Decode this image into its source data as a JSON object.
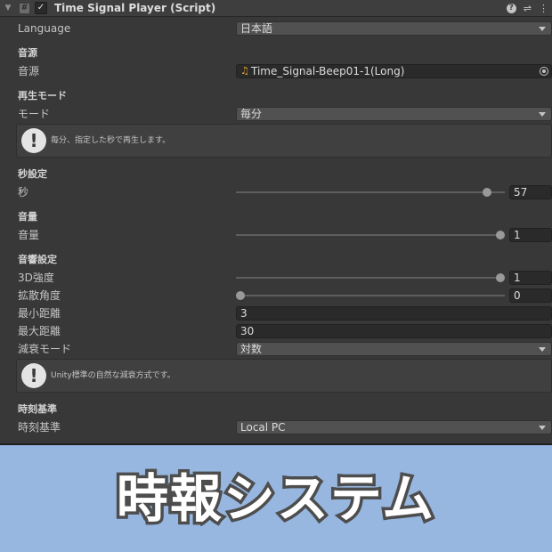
{
  "header": {
    "title": "Time Signal Player (Script)",
    "enabled": true,
    "icons": [
      "fold-arrow-icon",
      "script-icon",
      "checkbox-icon",
      "help-icon",
      "preset-icon",
      "kebab-menu-icon"
    ]
  },
  "language": {
    "label": "Language",
    "value": "日本語"
  },
  "audio": {
    "section": "音源",
    "label": "音源",
    "value": "Time_Signal-Beep01-1(Long)",
    "icon": "audio-clip-icon"
  },
  "playmode": {
    "section": "再生モード",
    "label": "モード",
    "value": "毎分",
    "help": "毎分、指定した秒で再生します。"
  },
  "seconds": {
    "section": "秒設定",
    "label": "秒",
    "value": "57",
    "fraction": 0.95
  },
  "volume": {
    "section": "音量",
    "label": "音量",
    "value": "1",
    "fraction": 1.0
  },
  "sound3d": {
    "section": "音響設定",
    "blend": {
      "label": "3D強度",
      "value": "1",
      "fraction": 1.0
    },
    "spread": {
      "label": "拡散角度",
      "value": "0",
      "fraction": 0.0
    },
    "min_distance": {
      "label": "最小距離",
      "value": "3"
    },
    "max_distance": {
      "label": "最大距離",
      "value": "30"
    },
    "rolloff": {
      "label": "減衰モード",
      "value": "対数"
    },
    "help": "Unity標準の自然な減衰方式です。"
  },
  "time": {
    "section": "時刻基準",
    "label": "時刻基準",
    "value": "Local PC"
  },
  "banner": {
    "text": "時報システム"
  }
}
